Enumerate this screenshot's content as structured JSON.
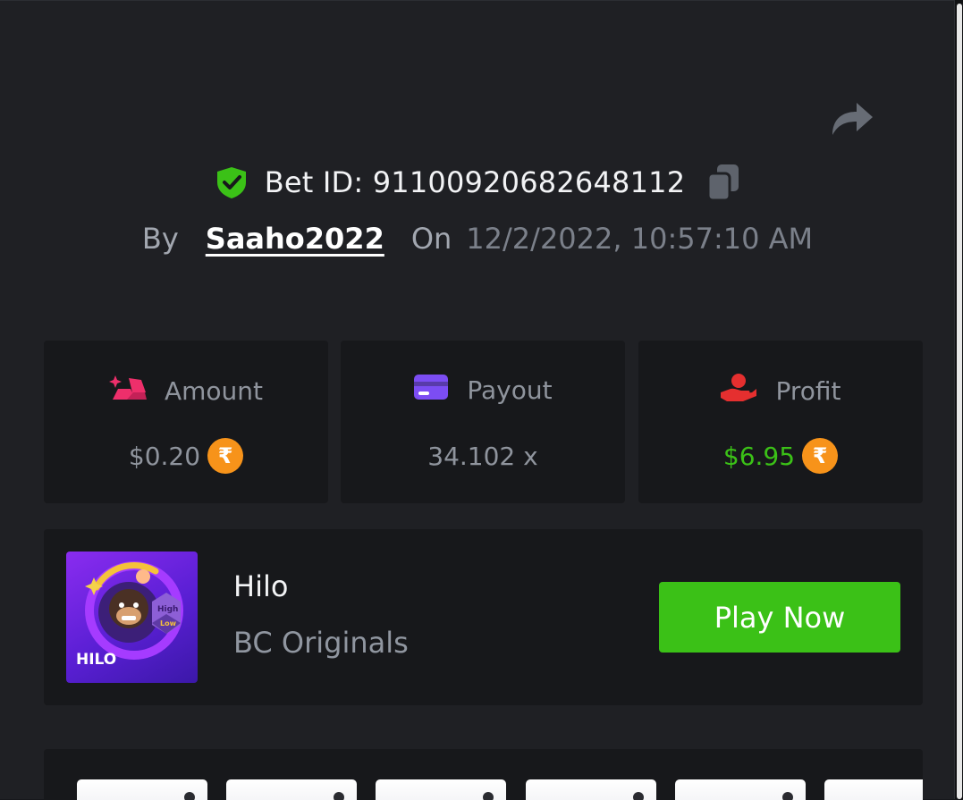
{
  "bet": {
    "id_text": "Bet ID: 91100920682648112",
    "by_label": "By",
    "username": "Saaho2022",
    "on_label": "On",
    "datetime": "12/2/2022, 10:57:10 AM"
  },
  "stats": {
    "amount": {
      "label": "Amount",
      "value": "$0.20",
      "currency_symbol": "₹",
      "icon": "gold-bars-icon"
    },
    "payout": {
      "label": "Payout",
      "value": "34.102 x",
      "icon": "credit-card-icon"
    },
    "profit": {
      "label": "Profit",
      "value": "$6.95",
      "currency_symbol": "₹",
      "icon": "money-hand-icon"
    }
  },
  "game": {
    "name": "Hilo",
    "provider": "BC Originals",
    "play_label": "Play Now",
    "thumb_title": "HILO",
    "thumb_high": "High",
    "thumb_low": "Low"
  },
  "colors": {
    "background": "#1f2024",
    "card": "#17181b",
    "accent_green": "#3bc117",
    "coin_orange": "#f7931a",
    "amount_pink": "#ee2f6b",
    "payout_purple": "#7c4df3",
    "profit_red": "#e52f2f",
    "muted_text": "#8f949d"
  },
  "icons": {
    "share": "share-arrow-icon",
    "shield": "verified-shield-icon",
    "copy": "copy-icon"
  }
}
